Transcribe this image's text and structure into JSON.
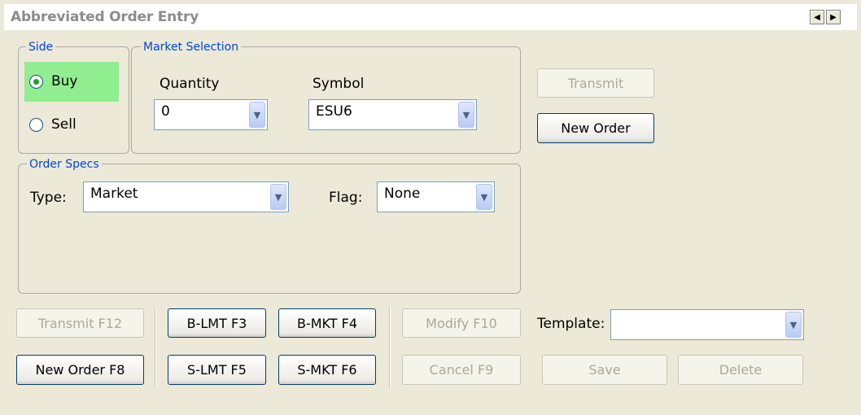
{
  "window": {
    "title": "Abbreviated Order Entry",
    "nav_icons": [
      "left-arrow-icon",
      "right-arrow-icon"
    ]
  },
  "side": {
    "legend": "Side",
    "options": [
      {
        "label": "Buy",
        "selected": true
      },
      {
        "label": "Sell",
        "selected": false
      }
    ]
  },
  "market_selection": {
    "legend": "Market Selection",
    "quantity_label": "Quantity",
    "quantity_value": "0",
    "symbol_label": "Symbol",
    "symbol_value": "ESU6"
  },
  "order_specs": {
    "legend": "Order Specs",
    "type_label": "Type:",
    "type_value": "Market",
    "flag_label": "Flag:",
    "flag_value": "None"
  },
  "top_buttons": {
    "transmit": "Transmit",
    "new_order": "New Order"
  },
  "bottom_buttons": {
    "transmit_f12": "Transmit F12",
    "new_order_f8": "New Order F8",
    "b_lmt_f3": "B-LMT F3",
    "b_mkt_f4": "B-MKT F4",
    "s_lmt_f5": "S-LMT F5",
    "s_mkt_f6": "S-MKT F6",
    "modify_f10": "Modify F10",
    "cancel_f9": "Cancel F9"
  },
  "template": {
    "label": "Template:",
    "value": "",
    "save": "Save",
    "delete": "Delete"
  },
  "colors": {
    "legend_text": "#0046d5",
    "buy_highlight": "#90ee90",
    "background": "#ece9d8"
  }
}
